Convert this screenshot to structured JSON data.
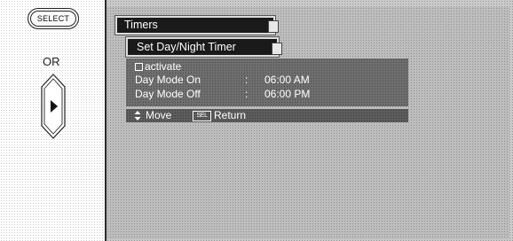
{
  "remote": {
    "select_label": "SELECT",
    "or_label": "OR",
    "dpad_icon": "right-arrow-icon"
  },
  "menu": {
    "title": "Timers",
    "subtitle": "Set Day/Night Timer",
    "activate_label": "activate",
    "activate_checked": false,
    "rows": [
      {
        "label": "Day Mode On",
        "separator": ":",
        "value": "06:00 AM"
      },
      {
        "label": "Day Mode Off",
        "separator": ":",
        "value": "06:00 PM"
      }
    ]
  },
  "hints": {
    "move_icon": "up-down-arrows-icon",
    "move_label": "Move",
    "sel_key": "SEL",
    "return_label": "Return"
  }
}
